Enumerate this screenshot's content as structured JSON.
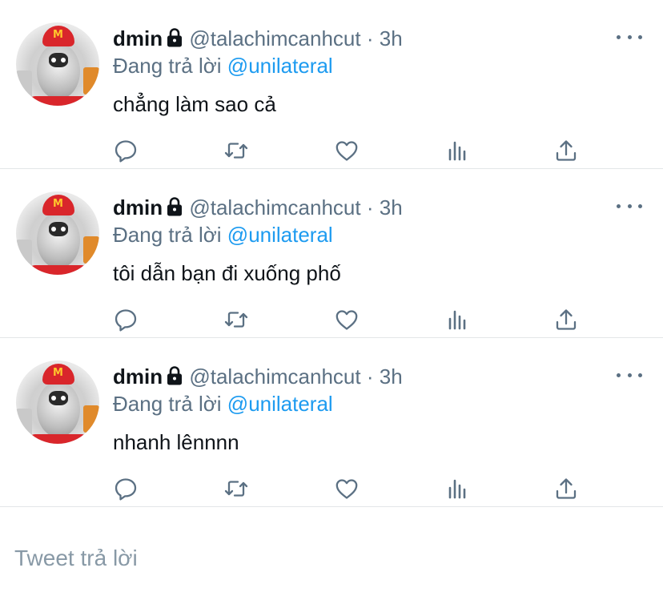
{
  "tweets": [
    {
      "name": "dmin",
      "handle": "@talachimcanhcut",
      "separator": "·",
      "time": "3h",
      "reply_prefix": "Đang trả lời",
      "reply_to": "@unilateral",
      "text": "chẳng làm sao cả"
    },
    {
      "name": "dmin",
      "handle": "@talachimcanhcut",
      "separator": "·",
      "time": "3h",
      "reply_prefix": "Đang trả lời",
      "reply_to": "@unilateral",
      "text": "tôi dẫn bạn đi xuống phố"
    },
    {
      "name": "dmin",
      "handle": "@talachimcanhcut",
      "separator": "·",
      "time": "3h",
      "reply_prefix": "Đang trả lời",
      "reply_to": "@unilateral",
      "text": "nhanh lênnnn"
    }
  ],
  "icons": {
    "reply": "reply-icon",
    "retweet": "retweet-icon",
    "like": "heart-icon",
    "analytics": "analytics-icon",
    "share": "share-icon",
    "more": "more-icon",
    "lock": "lock-icon"
  },
  "colors": {
    "text": "#0f1419",
    "secondary": "#5b7083",
    "link": "#1d9bf0",
    "divider": "#e3e6e8",
    "placeholder": "#8899a6"
  },
  "reply_box": {
    "placeholder": "Tweet trả lời"
  }
}
